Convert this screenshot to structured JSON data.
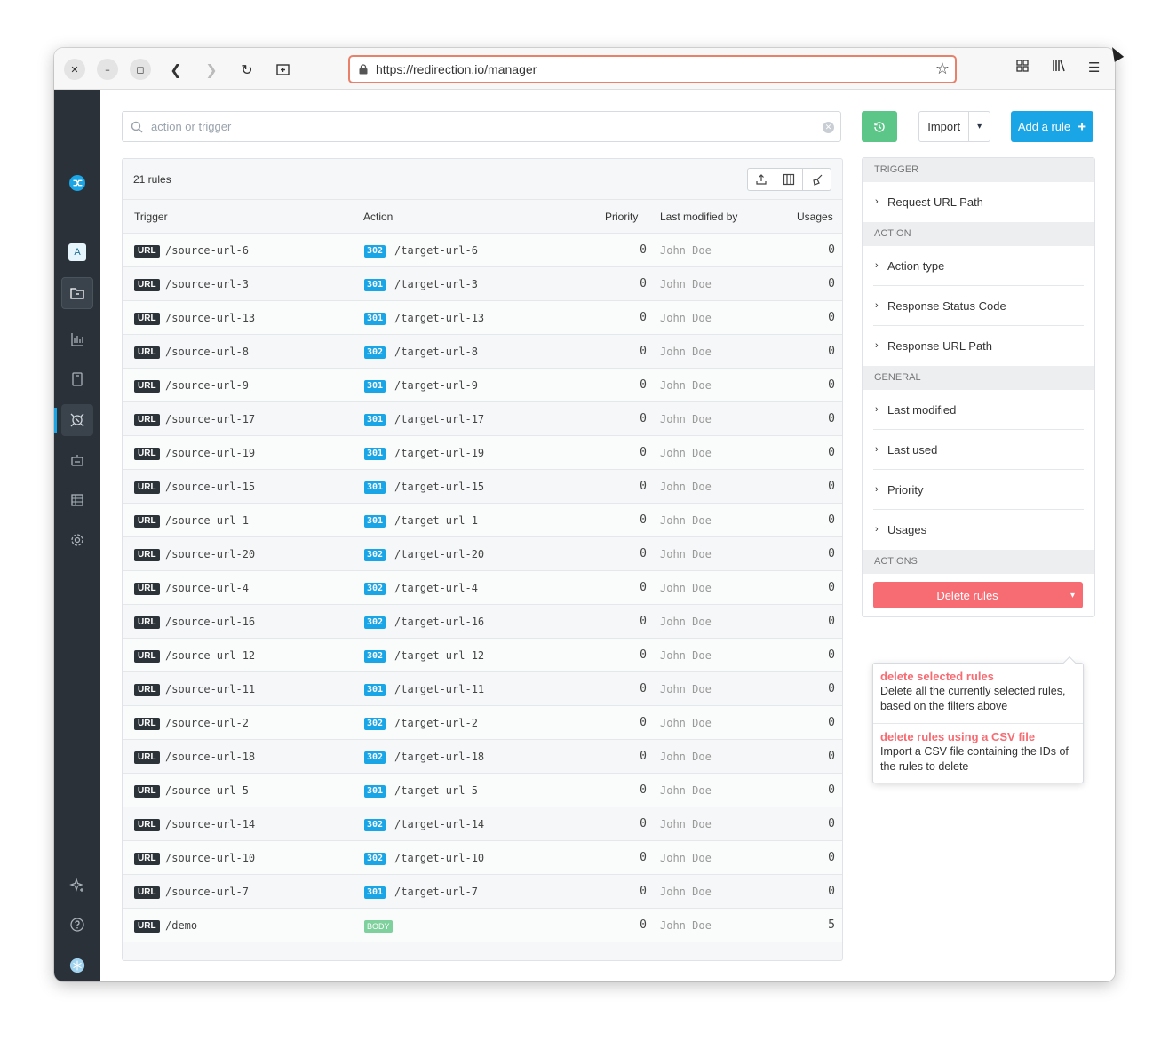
{
  "browser": {
    "url": "https://redirection.io/manager"
  },
  "icons": {
    "close": "close-icon",
    "minimize": "minimize-icon",
    "maximize": "maximize-icon",
    "back": "back-icon",
    "forward": "forward-icon",
    "reload": "reload-icon",
    "new_tab": "new-tab-icon",
    "lock": "lock-icon",
    "bookmark": "star-icon",
    "extensions": "grid-icon",
    "library": "library-icon",
    "menu": "hamburger-icon"
  },
  "sidebar": {
    "avatar_letter": "A"
  },
  "search": {
    "placeholder": "action or trigger"
  },
  "toolbar": {
    "import_label": "Import",
    "add_label": "Add a rule",
    "add_plus": "+"
  },
  "table": {
    "count_label": "21 rules",
    "columns": {
      "trigger": "Trigger",
      "action": "Action",
      "priority": "Priority",
      "modified_by": "Last modified by",
      "usages": "Usages"
    },
    "rows": [
      {
        "type": "URL",
        "trigger": "/source-url-6",
        "code": "302",
        "target": "/target-url-6",
        "priority": "0",
        "who": "John Doe",
        "usages": "0"
      },
      {
        "type": "URL",
        "trigger": "/source-url-3",
        "code": "301",
        "target": "/target-url-3",
        "priority": "0",
        "who": "John Doe",
        "usages": "0"
      },
      {
        "type": "URL",
        "trigger": "/source-url-13",
        "code": "301",
        "target": "/target-url-13",
        "priority": "0",
        "who": "John Doe",
        "usages": "0"
      },
      {
        "type": "URL",
        "trigger": "/source-url-8",
        "code": "302",
        "target": "/target-url-8",
        "priority": "0",
        "who": "John Doe",
        "usages": "0"
      },
      {
        "type": "URL",
        "trigger": "/source-url-9",
        "code": "301",
        "target": "/target-url-9",
        "priority": "0",
        "who": "John Doe",
        "usages": "0"
      },
      {
        "type": "URL",
        "trigger": "/source-url-17",
        "code": "301",
        "target": "/target-url-17",
        "priority": "0",
        "who": "John Doe",
        "usages": "0"
      },
      {
        "type": "URL",
        "trigger": "/source-url-19",
        "code": "301",
        "target": "/target-url-19",
        "priority": "0",
        "who": "John Doe",
        "usages": "0"
      },
      {
        "type": "URL",
        "trigger": "/source-url-15",
        "code": "301",
        "target": "/target-url-15",
        "priority": "0",
        "who": "John Doe",
        "usages": "0"
      },
      {
        "type": "URL",
        "trigger": "/source-url-1",
        "code": "301",
        "target": "/target-url-1",
        "priority": "0",
        "who": "John Doe",
        "usages": "0"
      },
      {
        "type": "URL",
        "trigger": "/source-url-20",
        "code": "302",
        "target": "/target-url-20",
        "priority": "0",
        "who": "John Doe",
        "usages": "0"
      },
      {
        "type": "URL",
        "trigger": "/source-url-4",
        "code": "302",
        "target": "/target-url-4",
        "priority": "0",
        "who": "John Doe",
        "usages": "0"
      },
      {
        "type": "URL",
        "trigger": "/source-url-16",
        "code": "302",
        "target": "/target-url-16",
        "priority": "0",
        "who": "John Doe",
        "usages": "0"
      },
      {
        "type": "URL",
        "trigger": "/source-url-12",
        "code": "302",
        "target": "/target-url-12",
        "priority": "0",
        "who": "John Doe",
        "usages": "0"
      },
      {
        "type": "URL",
        "trigger": "/source-url-11",
        "code": "301",
        "target": "/target-url-11",
        "priority": "0",
        "who": "John Doe",
        "usages": "0"
      },
      {
        "type": "URL",
        "trigger": "/source-url-2",
        "code": "302",
        "target": "/target-url-2",
        "priority": "0",
        "who": "John Doe",
        "usages": "0"
      },
      {
        "type": "URL",
        "trigger": "/source-url-18",
        "code": "302",
        "target": "/target-url-18",
        "priority": "0",
        "who": "John Doe",
        "usages": "0"
      },
      {
        "type": "URL",
        "trigger": "/source-url-5",
        "code": "301",
        "target": "/target-url-5",
        "priority": "0",
        "who": "John Doe",
        "usages": "0"
      },
      {
        "type": "URL",
        "trigger": "/source-url-14",
        "code": "302",
        "target": "/target-url-14",
        "priority": "0",
        "who": "John Doe",
        "usages": "0"
      },
      {
        "type": "URL",
        "trigger": "/source-url-10",
        "code": "302",
        "target": "/target-url-10",
        "priority": "0",
        "who": "John Doe",
        "usages": "0"
      },
      {
        "type": "URL",
        "trigger": "/source-url-7",
        "code": "301",
        "target": "/target-url-7",
        "priority": "0",
        "who": "John Doe",
        "usages": "0"
      },
      {
        "type": "URL",
        "trigger": "/demo",
        "code": "BODY",
        "target": "",
        "priority": "0",
        "who": "John Doe",
        "usages": "5"
      }
    ]
  },
  "filters": {
    "sections": {
      "trigger": "TRIGGER",
      "action": "ACTION",
      "general": "GENERAL",
      "actions": "ACTIONS"
    },
    "trigger_items": [
      "Request URL Path"
    ],
    "action_items": [
      "Action type",
      "Response Status Code",
      "Response URL Path"
    ],
    "general_items": [
      "Last modified",
      "Last used",
      "Priority",
      "Usages"
    ],
    "delete_label": "Delete rules"
  },
  "delete_menu": {
    "items": [
      {
        "title": "delete selected rules",
        "desc": "Delete all the currently selected rules, based on the filters above"
      },
      {
        "title": "delete rules using a CSV file",
        "desc": "Import a CSV file containing the IDs of the rules to delete"
      }
    ]
  },
  "colors": {
    "accent": "#1aa6e6",
    "success": "#5bc687",
    "danger": "#f76b72",
    "sidebar_bg": "#2b3138"
  }
}
